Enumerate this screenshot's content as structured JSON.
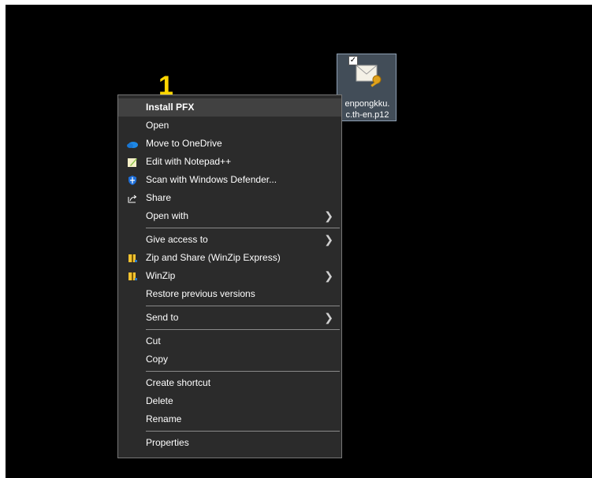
{
  "desktop": {
    "file": {
      "label_line1": "enpongkku.",
      "label_line2": "c.th-en.p12",
      "checked": true
    }
  },
  "annotation": {
    "step_number": "1",
    "color": "#ffd600"
  },
  "context_menu": {
    "items": [
      {
        "label": "Install PFX",
        "highlighted": true
      },
      {
        "label": "Open"
      },
      {
        "label": "Move to OneDrive",
        "icon": "onedrive-cloud-icon"
      },
      {
        "label": "Edit with Notepad++",
        "icon": "notepadpp-icon"
      },
      {
        "label": "Scan with Windows Defender...",
        "icon": "windows-defender-shield-icon"
      },
      {
        "label": "Share",
        "icon": "share-icon"
      },
      {
        "label": "Open with",
        "submenu": true
      },
      {
        "label": "Give access to",
        "submenu": true
      },
      {
        "label": "Zip and Share (WinZip Express)",
        "icon": "winzip-icon"
      },
      {
        "label": "WinZip",
        "icon": "winzip-icon",
        "submenu": true
      },
      {
        "label": "Restore previous versions"
      },
      {
        "label": "Send to",
        "submenu": true
      },
      {
        "label": "Cut"
      },
      {
        "label": "Copy"
      },
      {
        "label": "Create shortcut"
      },
      {
        "label": "Delete"
      },
      {
        "label": "Rename"
      },
      {
        "label": "Properties"
      }
    ]
  }
}
